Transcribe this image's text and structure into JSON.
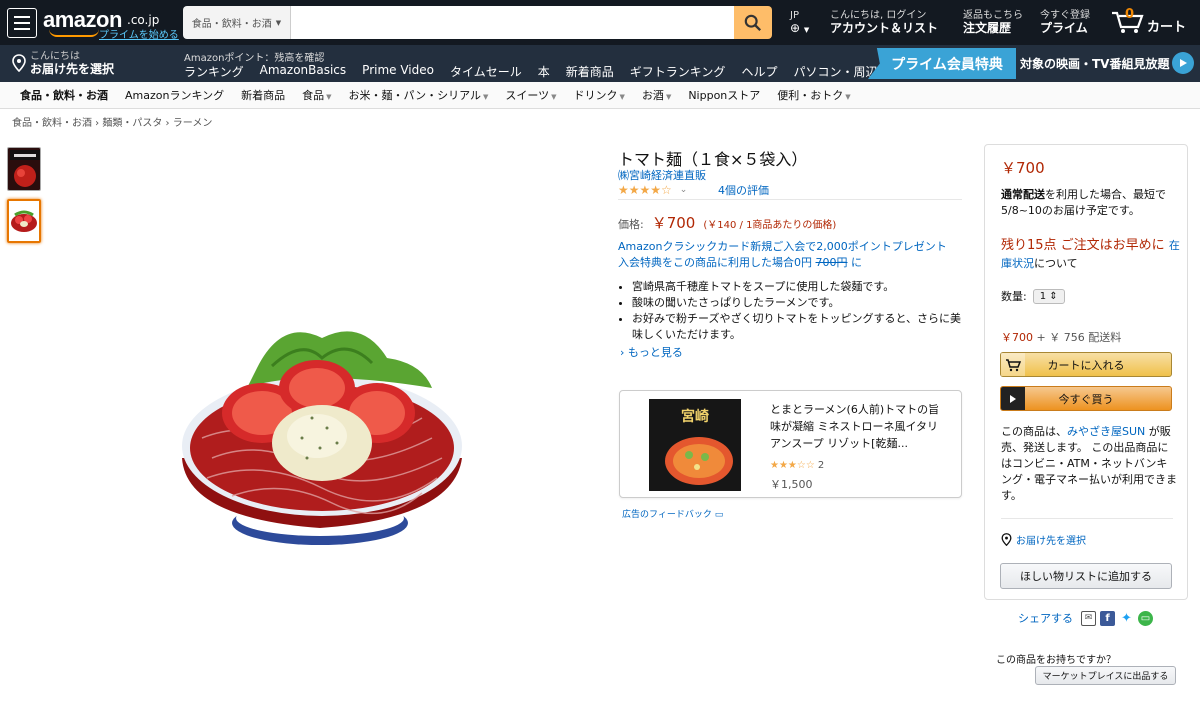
{
  "header": {
    "logo_text": "amazon",
    "logo_tld": ".co.jp",
    "logo_prime": "プライムを始める",
    "search_category": "食品・飲料・お酒",
    "search_placeholder": "",
    "lang": "JP",
    "account_greeting": "こんにちは, ログイン",
    "account_label": "アカウント＆リスト",
    "orders_top": "返品もこちら",
    "orders_label": "注文履歴",
    "prime_top": "今すぐ登録",
    "prime_label": "プライム",
    "cart_count": "0",
    "cart_label": "カート"
  },
  "nav": {
    "deliver_hello": "こんにちは",
    "deliver_label": "お届け先を選択",
    "points": "Amazonポイント：残高を確認",
    "links": [
      "ランキング",
      "AmazonBasics",
      "Prime Video",
      "タイムセール",
      "本",
      "新着商品",
      "ギフトランキング",
      "ヘルプ",
      "パソコン・周辺機器"
    ],
    "prime_banner": "プライム会員特典",
    "promo_text": "対象の映画・TV番組見放題"
  },
  "subnav": {
    "items": [
      "食品・飲料・お酒",
      "Amazonランキング",
      "新着商品",
      "食品",
      "お米・麺・パン・シリアル",
      "スイーツ",
      "ドリンク",
      "お酒",
      "Nipponストア",
      "便利・おトク"
    ]
  },
  "breadcrumb": "食品・飲料・お酒 › 麺類・パスタ › ラーメン",
  "product": {
    "title": "トマト麺（１食×５袋入）",
    "brand": "㈱宮崎経済連直販",
    "rating": 4,
    "rating_stars": "★★★★☆",
    "reviews": "4個の評価",
    "price_label": "価格:",
    "price": "￥700",
    "unit_price": "(￥140 / 1商品あたりの価格)",
    "promo_line1": "Amazonクラシックカード新規ご入会で2,000ポイントプレゼント",
    "promo_line2_a": "入会特典をこの商品に利用した場合0円",
    "promo_line2_strike": "700円",
    "promo_line2_b": "に",
    "bullets": [
      "宮崎県高千穂産トマトをスープに使用した袋麺です。",
      "酸味の聞いたさっぱりしたラーメンです。",
      "お好みで粉チーズやざく切りトマトをトッピングすると、さらに美味しくいただけます。"
    ],
    "see_more": "› もっと見る"
  },
  "ad": {
    "title": "とまとラーメン(6人前)トマトの旨味が凝縮 ミネストローネ風イタリアンスープ リゾット[乾麺...",
    "stars": "★★★☆☆",
    "rating": 3.5,
    "count": "2",
    "price": "￥1,500",
    "feedback": "広告のフィードバック"
  },
  "buybox": {
    "price": "￥700",
    "delivery_bold": "通常配送",
    "delivery_text": "を利用した場合、最短で5/8~10のお届け予定です。",
    "stock": "残り15点 ご注文はお早めに",
    "stock_link": "在庫状況",
    "stock_tail": "について",
    "qty_label": "数量:",
    "qty_value": "1",
    "ship_price": "￥700",
    "ship_rest": "+ ￥ 756 配送料",
    "cart_button": "カートに入れる",
    "buy_button": "今すぐ買う",
    "seller_pre": "この商品は、",
    "seller_name": "みやざき屋SUN",
    "seller_post": "が販売、発送します。 この出品商品にはコンビニ・ATM・ネットバンキング・電子マネー払いが利用できます。",
    "address": "お届け先を選択",
    "wishlist": "ほしい物リストに追加する"
  },
  "share": {
    "label": "シェアする"
  },
  "marketplace": {
    "question": "この商品をお持ちですか？",
    "button": "マーケットプレイスに出品する"
  },
  "colors": {
    "header_bg": "#131921",
    "nav_bg": "#232f3e",
    "price": "#b12704",
    "link": "#0066c0",
    "accent": "#febd69"
  }
}
